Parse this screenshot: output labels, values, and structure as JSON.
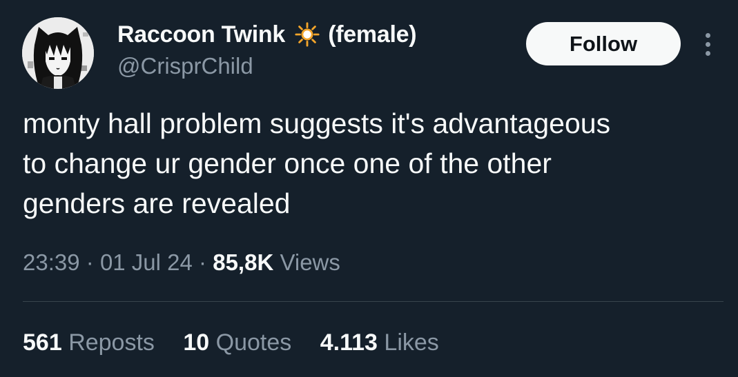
{
  "user": {
    "display_name": "Raccoon Twink",
    "emoji_icon": "sun-emoji",
    "display_suffix": "(female)",
    "handle": "@CrisprChild"
  },
  "follow_button_label": "Follow",
  "tweet": {
    "lines": [
      "monty hall problem suggests it's advantageous",
      "to change ur gender once one of the other",
      "genders are revealed"
    ]
  },
  "meta": {
    "time": "23:39",
    "separator": "·",
    "date": "01 Jul 24",
    "views_count": "85,8K",
    "views_label": "Views"
  },
  "stats": {
    "reposts_count": "561",
    "reposts_label": "Reposts",
    "quotes_count": "10",
    "quotes_label": "Quotes",
    "likes_count": "4.113",
    "likes_label": "Likes"
  },
  "colors": {
    "background": "#15202b",
    "text": "#f7f9f9",
    "secondary_text": "#8b98a5",
    "divider": "#38444d",
    "sun": "#f4a52a"
  }
}
